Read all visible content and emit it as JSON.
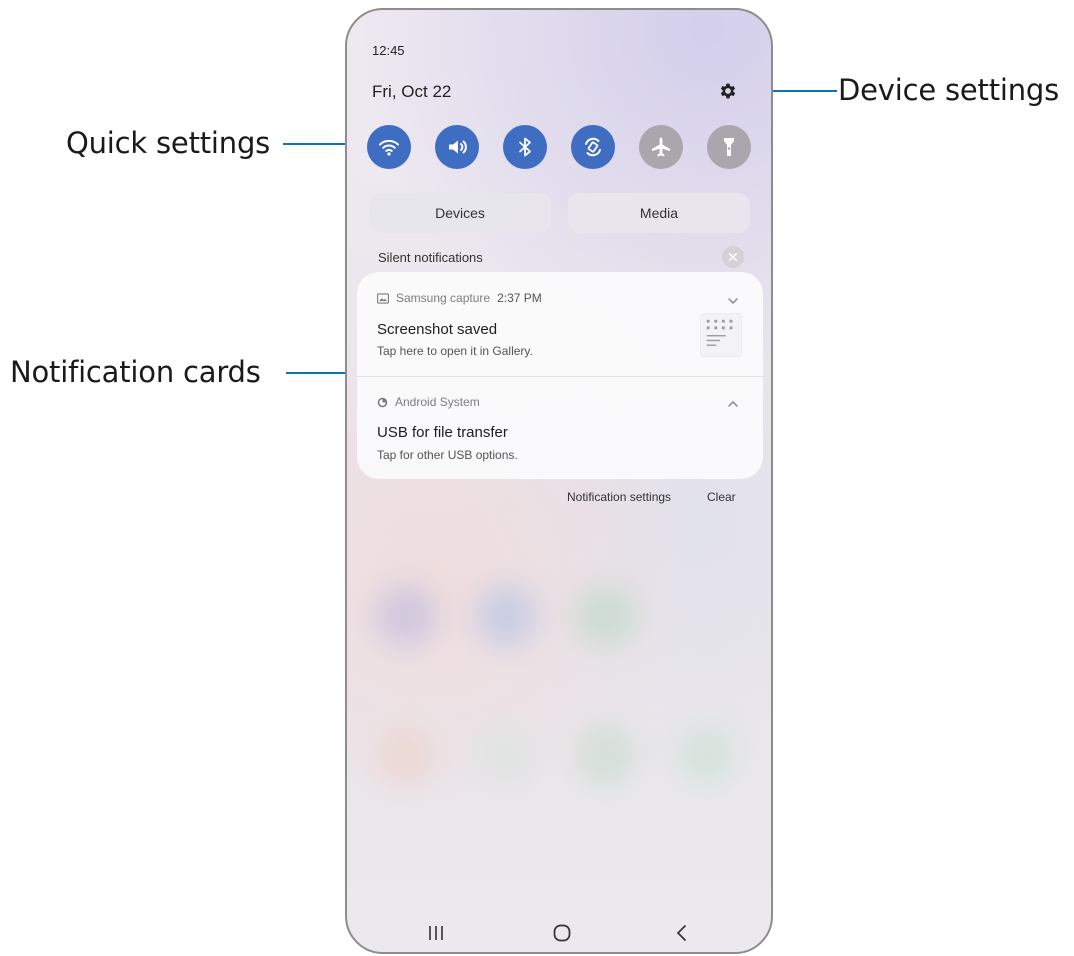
{
  "callouts": {
    "quick_settings": "Quick settings",
    "device_settings": "Device settings",
    "notification_cards": "Notification cards"
  },
  "status": {
    "time": "12:45",
    "date": "Fri, Oct 22"
  },
  "quick_settings": [
    {
      "icon": "wifi-icon",
      "state": "on"
    },
    {
      "icon": "sound-icon",
      "state": "on"
    },
    {
      "icon": "bluetooth-icon",
      "state": "on"
    },
    {
      "icon": "auto-rotate-icon",
      "state": "on"
    },
    {
      "icon": "airplane-icon",
      "state": "off"
    },
    {
      "icon": "flashlight-icon",
      "state": "off"
    }
  ],
  "panel_buttons": {
    "devices": "Devices",
    "media": "Media"
  },
  "silent_header": "Silent notifications",
  "notifications": [
    {
      "app": "Samsung capture",
      "time": "2:37 PM",
      "title": "Screenshot saved",
      "body": "Tap here to open it in Gallery."
    },
    {
      "app": "Android System",
      "title": "USB for file transfer",
      "body": "Tap for other USB options."
    }
  ],
  "footer": {
    "settings": "Notification settings",
    "clear": "Clear"
  },
  "colors": {
    "accent": "#0b74b8",
    "toggle_on": "#3f6dc2",
    "toggle_off": "#a9a6ad"
  }
}
